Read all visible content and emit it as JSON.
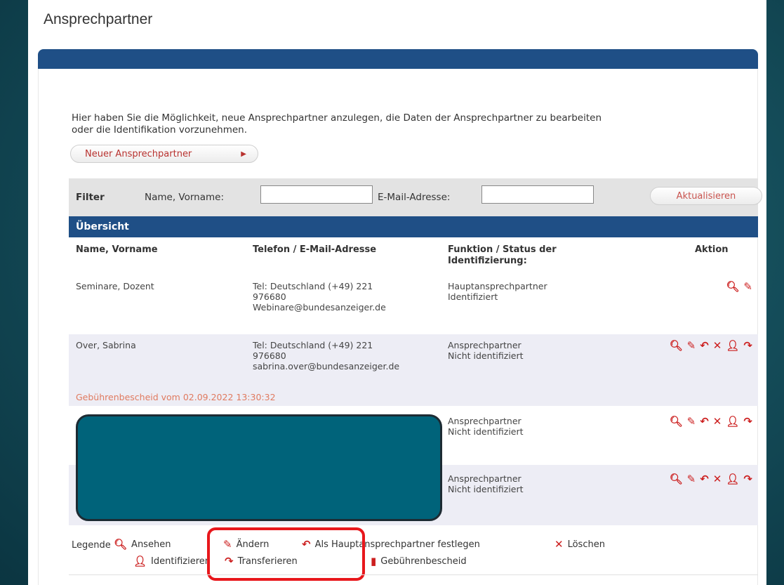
{
  "page": {
    "title": "Ansprechpartner"
  },
  "intro": {
    "line1": "Hier haben Sie die Möglichkeit, neue Ansprechpartner anzulegen, die Daten der Ansprechpartner zu bearbeiten",
    "line2": "oder die Identifikation vorzunehmen."
  },
  "new_button": {
    "label": "Neuer Ansprechpartner",
    "arrow": "▶"
  },
  "filter": {
    "title": "Filter",
    "name_label": "Name, Vorname:",
    "name_value": "",
    "email_label": "E-Mail-Adresse:",
    "email_value": "",
    "refresh_label": "Aktualisieren"
  },
  "overview": {
    "title": "Übersicht",
    "columns": [
      "Name, Vorname",
      "Telefon / E-Mail-Adresse",
      "Funktion / Status der",
      "Identifizierung:",
      "Aktion"
    ],
    "rows": [
      {
        "name": "Seminare, Dozent",
        "phone1": "Tel: Deutschland (+49) 221",
        "phone2": "976680",
        "email": "Webinare@bundesanzeiger.de",
        "function": "Hauptansprechpartner",
        "status": "Identifiziert"
      },
      {
        "name": "Over, Sabrina",
        "phone1": "Tel: Deutschland (+49) 221",
        "phone2": "976680",
        "email": "sabrina.over@bundesanzeiger.de",
        "function": "Ansprechpartner",
        "status": "Nicht identifiziert",
        "note": "Gebührenbescheid vom 02.09.2022 13:30:32"
      },
      {
        "function": "Ansprechpartner",
        "status": "Nicht identifiziert"
      },
      {
        "function": "Ansprechpartner",
        "status": "Nicht identifiziert"
      }
    ]
  },
  "icons": {
    "view": "🔍︎",
    "edit": "✎",
    "reply": "↶",
    "delete": "✕",
    "identify": "👤︎",
    "transfer": "↷",
    "fee": "▮"
  },
  "legend": {
    "title": "Legende",
    "view": "Ansehen",
    "edit": "Ändern",
    "main": "Als Hauptansprechpartner festlegen",
    "delete": "Löschen",
    "identify": "Identifizieren",
    "transfer": "Transferieren",
    "fee": "Gebührenbescheid"
  },
  "colors": {
    "accent_blue": "#1f4f86",
    "action_red": "#cc1f1f",
    "highlight_red": "#e8171c",
    "redaction": "#00637a"
  }
}
